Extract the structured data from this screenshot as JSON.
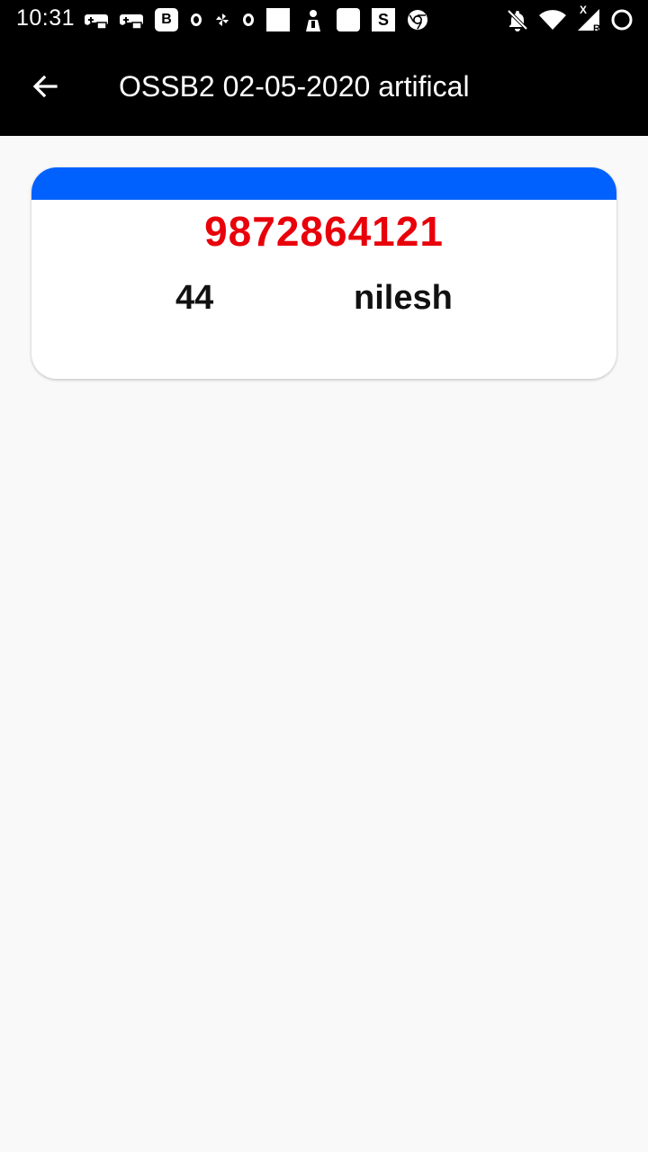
{
  "status_bar": {
    "time": "10:31",
    "left_icons": [
      "game-controller-icon",
      "game-controller-icon",
      "b-badge-icon",
      "o-circle-icon",
      "pinwheel-icon",
      "o-circle-icon",
      "white-square-icon",
      "people-icon",
      "white-square-icon",
      "s-badge-icon",
      "chrome-icon"
    ],
    "right_icons": [
      "bell-off-icon",
      "wifi-icon",
      "signal-icon",
      "circle-icon"
    ],
    "b_badge": "B",
    "s_badge": "S",
    "signal_x": "X",
    "signal_r": "R"
  },
  "app_bar": {
    "title": "OSSB2 02-05-2020 artifical",
    "background": "#000000"
  },
  "card": {
    "header_color": "#0061fe",
    "phone": "9872864121",
    "phone_color": "#e8000b",
    "number": "44",
    "name": "nilesh"
  }
}
